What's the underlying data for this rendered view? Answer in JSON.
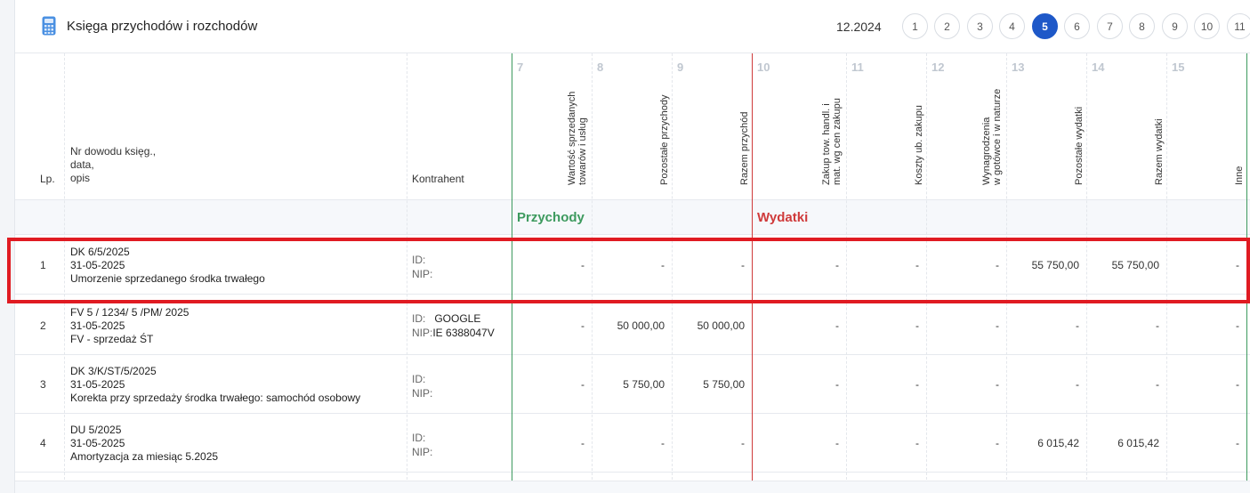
{
  "header": {
    "title": "Księga przychodów i rozchodów",
    "period": "12.2024",
    "pages": [
      "1",
      "2",
      "3",
      "4",
      "5",
      "6",
      "7",
      "8",
      "9",
      "10",
      "11"
    ],
    "active_page": "5",
    "accent_color": "#1e58c8"
  },
  "table": {
    "head": {
      "lp": "Lp.",
      "doc_line1": "Nr dowodu księg.,",
      "doc_line2": "data,",
      "doc_line3": "opis",
      "kontrahent": "Kontrahent"
    },
    "columns": [
      {
        "num": "7",
        "label1": "Wartość sprzedanych",
        "label2": "towarów i usług"
      },
      {
        "num": "8",
        "label1": "Pozostałe przychody",
        "label2": ""
      },
      {
        "num": "9",
        "label1": "Razem przychód",
        "label2": ""
      },
      {
        "num": "10",
        "label1": "Zakup tow. handl. i",
        "label2": "mat. wg cen zakupu"
      },
      {
        "num": "11",
        "label1": "Koszty ub. zakupu",
        "label2": ""
      },
      {
        "num": "12",
        "label1": "Wynagrodzenia",
        "label2": "w gotówce i w naturze"
      },
      {
        "num": "13",
        "label1": "Pozostałe wydatki",
        "label2": ""
      },
      {
        "num": "14",
        "label1": "Razem wydatki",
        "label2": ""
      },
      {
        "num": "15",
        "label1": "Inne",
        "label2": ""
      }
    ],
    "sections": {
      "income": "Przychody",
      "expenses": "Wydatki",
      "income_color": "#3d9a5e",
      "expenses_color": "#cf3a3a"
    },
    "rows": [
      {
        "lp": "1",
        "doc": "DK 6/5/2025",
        "date": "31-05-2025",
        "desc": "Umorzenie sprzedanego środka trwałego",
        "id_label": "ID:",
        "id_value": "",
        "nip_label": "NIP:",
        "nip_value": "",
        "values": [
          "-",
          "-",
          "-",
          "-",
          "-",
          "-",
          "55 750,00",
          "55 750,00",
          "-"
        ]
      },
      {
        "lp": "2",
        "doc": "FV 5 / 1234/ 5 /PM/ 2025",
        "date": "31-05-2025",
        "desc": "FV - sprzedaż ŚT",
        "id_label": "ID:",
        "id_value": "GOOGLE",
        "nip_label": "NIP:",
        "nip_value": "IE 6388047V",
        "values": [
          "-",
          "50 000,00",
          "50 000,00",
          "-",
          "-",
          "-",
          "-",
          "-",
          "-"
        ]
      },
      {
        "lp": "3",
        "doc": "DK 3/K/ST/5/2025",
        "date": "31-05-2025",
        "desc": "Korekta przy sprzedaży środka trwałego: samochód osobowy",
        "id_label": "ID:",
        "id_value": "",
        "nip_label": "NIP:",
        "nip_value": "",
        "values": [
          "-",
          "5 750,00",
          "5 750,00",
          "-",
          "-",
          "-",
          "-",
          "-",
          "-"
        ]
      },
      {
        "lp": "4",
        "doc": "DU 5/2025",
        "date": "31-05-2025",
        "desc": "Amortyzacja za miesiąc 5.2025",
        "id_label": "ID:",
        "id_value": "",
        "nip_label": "NIP:",
        "nip_value": "",
        "values": [
          "-",
          "-",
          "-",
          "-",
          "-",
          "-",
          "6 015,42",
          "6 015,42",
          "-"
        ]
      }
    ]
  }
}
